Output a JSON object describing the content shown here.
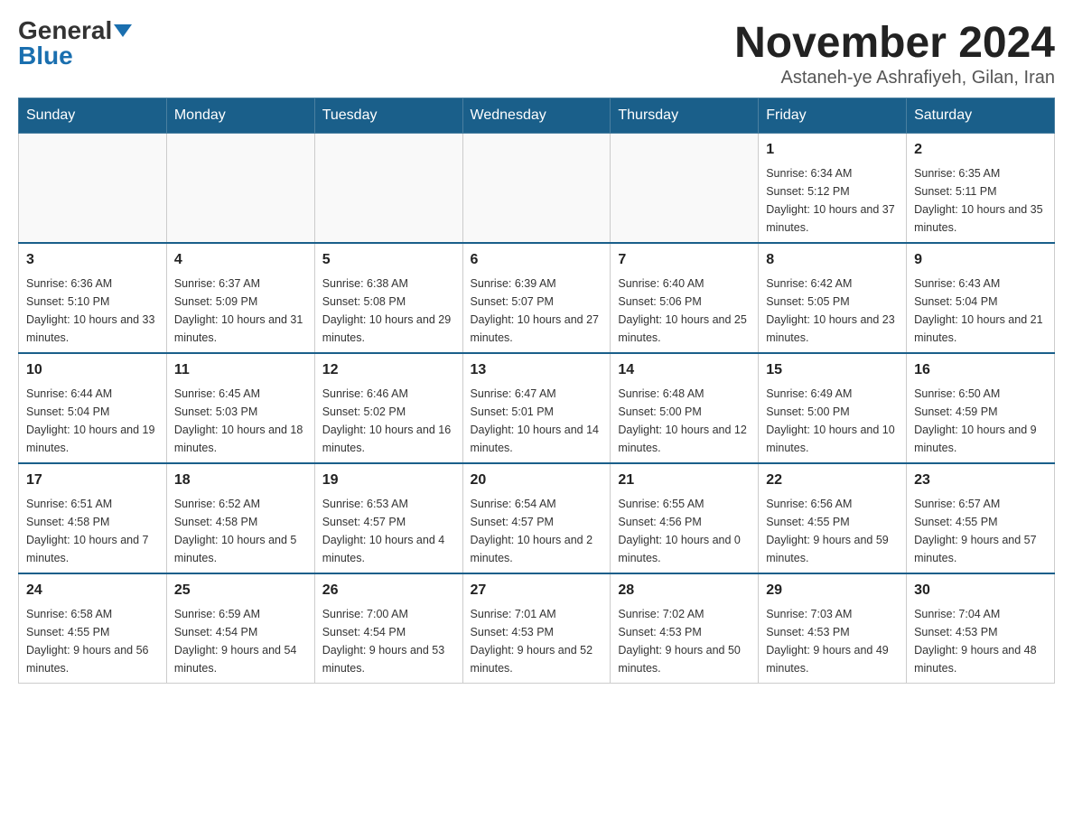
{
  "logo": {
    "general": "General",
    "blue": "Blue"
  },
  "title": "November 2024",
  "location": "Astaneh-ye Ashrafiyeh, Gilan, Iran",
  "days_of_week": [
    "Sunday",
    "Monday",
    "Tuesday",
    "Wednesday",
    "Thursday",
    "Friday",
    "Saturday"
  ],
  "weeks": [
    [
      {
        "day": "",
        "info": ""
      },
      {
        "day": "",
        "info": ""
      },
      {
        "day": "",
        "info": ""
      },
      {
        "day": "",
        "info": ""
      },
      {
        "day": "",
        "info": ""
      },
      {
        "day": "1",
        "info": "Sunrise: 6:34 AM\nSunset: 5:12 PM\nDaylight: 10 hours and 37 minutes."
      },
      {
        "day": "2",
        "info": "Sunrise: 6:35 AM\nSunset: 5:11 PM\nDaylight: 10 hours and 35 minutes."
      }
    ],
    [
      {
        "day": "3",
        "info": "Sunrise: 6:36 AM\nSunset: 5:10 PM\nDaylight: 10 hours and 33 minutes."
      },
      {
        "day": "4",
        "info": "Sunrise: 6:37 AM\nSunset: 5:09 PM\nDaylight: 10 hours and 31 minutes."
      },
      {
        "day": "5",
        "info": "Sunrise: 6:38 AM\nSunset: 5:08 PM\nDaylight: 10 hours and 29 minutes."
      },
      {
        "day": "6",
        "info": "Sunrise: 6:39 AM\nSunset: 5:07 PM\nDaylight: 10 hours and 27 minutes."
      },
      {
        "day": "7",
        "info": "Sunrise: 6:40 AM\nSunset: 5:06 PM\nDaylight: 10 hours and 25 minutes."
      },
      {
        "day": "8",
        "info": "Sunrise: 6:42 AM\nSunset: 5:05 PM\nDaylight: 10 hours and 23 minutes."
      },
      {
        "day": "9",
        "info": "Sunrise: 6:43 AM\nSunset: 5:04 PM\nDaylight: 10 hours and 21 minutes."
      }
    ],
    [
      {
        "day": "10",
        "info": "Sunrise: 6:44 AM\nSunset: 5:04 PM\nDaylight: 10 hours and 19 minutes."
      },
      {
        "day": "11",
        "info": "Sunrise: 6:45 AM\nSunset: 5:03 PM\nDaylight: 10 hours and 18 minutes."
      },
      {
        "day": "12",
        "info": "Sunrise: 6:46 AM\nSunset: 5:02 PM\nDaylight: 10 hours and 16 minutes."
      },
      {
        "day": "13",
        "info": "Sunrise: 6:47 AM\nSunset: 5:01 PM\nDaylight: 10 hours and 14 minutes."
      },
      {
        "day": "14",
        "info": "Sunrise: 6:48 AM\nSunset: 5:00 PM\nDaylight: 10 hours and 12 minutes."
      },
      {
        "day": "15",
        "info": "Sunrise: 6:49 AM\nSunset: 5:00 PM\nDaylight: 10 hours and 10 minutes."
      },
      {
        "day": "16",
        "info": "Sunrise: 6:50 AM\nSunset: 4:59 PM\nDaylight: 10 hours and 9 minutes."
      }
    ],
    [
      {
        "day": "17",
        "info": "Sunrise: 6:51 AM\nSunset: 4:58 PM\nDaylight: 10 hours and 7 minutes."
      },
      {
        "day": "18",
        "info": "Sunrise: 6:52 AM\nSunset: 4:58 PM\nDaylight: 10 hours and 5 minutes."
      },
      {
        "day": "19",
        "info": "Sunrise: 6:53 AM\nSunset: 4:57 PM\nDaylight: 10 hours and 4 minutes."
      },
      {
        "day": "20",
        "info": "Sunrise: 6:54 AM\nSunset: 4:57 PM\nDaylight: 10 hours and 2 minutes."
      },
      {
        "day": "21",
        "info": "Sunrise: 6:55 AM\nSunset: 4:56 PM\nDaylight: 10 hours and 0 minutes."
      },
      {
        "day": "22",
        "info": "Sunrise: 6:56 AM\nSunset: 4:55 PM\nDaylight: 9 hours and 59 minutes."
      },
      {
        "day": "23",
        "info": "Sunrise: 6:57 AM\nSunset: 4:55 PM\nDaylight: 9 hours and 57 minutes."
      }
    ],
    [
      {
        "day": "24",
        "info": "Sunrise: 6:58 AM\nSunset: 4:55 PM\nDaylight: 9 hours and 56 minutes."
      },
      {
        "day": "25",
        "info": "Sunrise: 6:59 AM\nSunset: 4:54 PM\nDaylight: 9 hours and 54 minutes."
      },
      {
        "day": "26",
        "info": "Sunrise: 7:00 AM\nSunset: 4:54 PM\nDaylight: 9 hours and 53 minutes."
      },
      {
        "day": "27",
        "info": "Sunrise: 7:01 AM\nSunset: 4:53 PM\nDaylight: 9 hours and 52 minutes."
      },
      {
        "day": "28",
        "info": "Sunrise: 7:02 AM\nSunset: 4:53 PM\nDaylight: 9 hours and 50 minutes."
      },
      {
        "day": "29",
        "info": "Sunrise: 7:03 AM\nSunset: 4:53 PM\nDaylight: 9 hours and 49 minutes."
      },
      {
        "day": "30",
        "info": "Sunrise: 7:04 AM\nSunset: 4:53 PM\nDaylight: 9 hours and 48 minutes."
      }
    ]
  ]
}
